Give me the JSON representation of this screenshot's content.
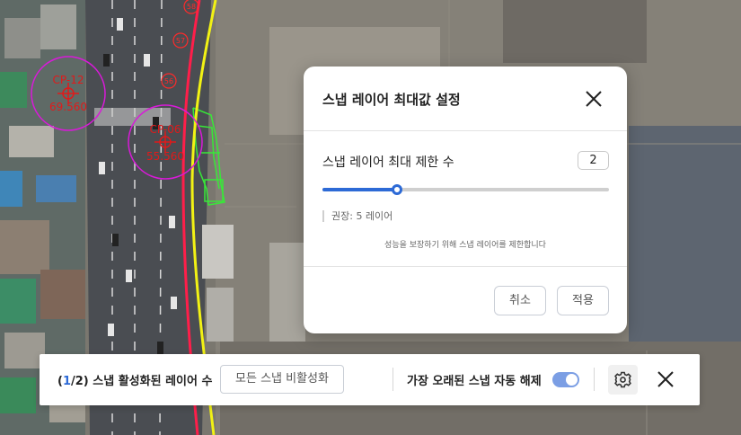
{
  "map": {
    "markers": [
      {
        "code": "CP-12",
        "value": "69.560"
      },
      {
        "code": "CP-06",
        "value": "55.560"
      }
    ],
    "road_numbers": [
      "58",
      "57",
      "56"
    ]
  },
  "modal": {
    "title": "스냅 레이어 최대값 설정",
    "limit_label": "스냅 레이어 최대 제한 수",
    "value": "2",
    "slider_fraction": 0.26,
    "recommend": "권장: 5 레이어",
    "note": "성능을 보장하기 위해 스냅 레이어를 제한합니다",
    "cancel_label": "취소",
    "apply_label": "적용",
    "accent_color": "#2d6ad6"
  },
  "toolbar": {
    "open_paren": "(",
    "current": "1",
    "total_and_label": "/2) 스냅 활성화된 레이어 수",
    "disable_all_label": "모든 스냅 비활성화",
    "auto_release_label": "가장 오래된 스냅 자동 해제",
    "auto_release_on": true,
    "settings_icon": "gear-icon",
    "close_icon": "close-icon"
  }
}
